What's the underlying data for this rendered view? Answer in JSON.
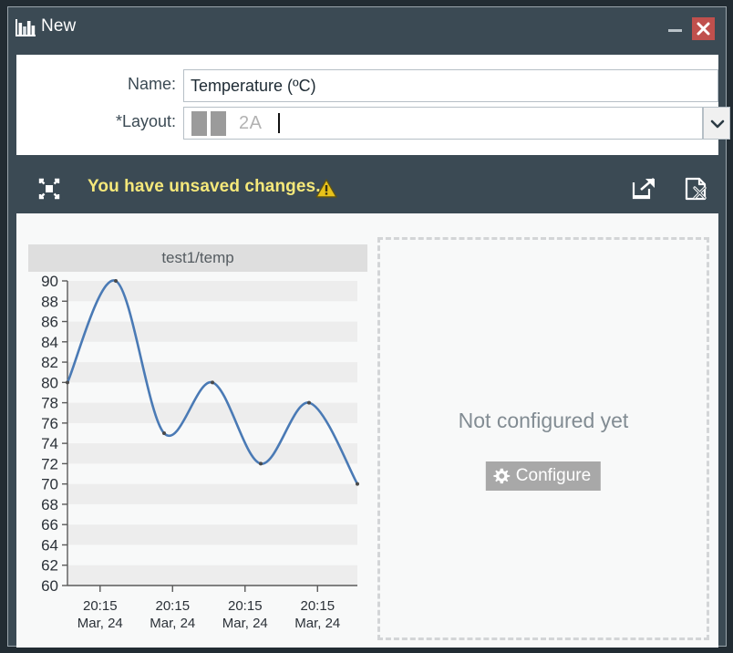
{
  "window": {
    "title": "New",
    "title_icon": "bar-chart-icon",
    "minimize_label": "–",
    "close_label": "✕",
    "close_color": "#c0504d"
  },
  "form": {
    "name": {
      "label": "Name:",
      "value": "Temperature (ºC)",
      "placeholder": ""
    },
    "layout": {
      "label": "*Layout:",
      "value": "2A",
      "swatch_count": 2,
      "dropdown_icon": "chevron-down-icon"
    }
  },
  "toolbar": {
    "expand_icon": "fullscreen-expand-icon",
    "status_message": "You have unsaved changes.",
    "status_color": "#f5e87a",
    "warning_icon": "warning-triangle-icon",
    "popout_icon": "open-in-new-window-icon",
    "discard_icon": "discard-document-icon"
  },
  "placeholder": {
    "message": "Not configured yet",
    "configure_label": "Configure",
    "configure_icon": "gear-icon"
  },
  "chart_data": {
    "type": "line",
    "title": "test1/temp",
    "xlabel": "",
    "ylabel": "",
    "ylim": [
      60,
      90
    ],
    "yticks": [
      90,
      88,
      86,
      84,
      82,
      80,
      78,
      76,
      74,
      72,
      70,
      68,
      66,
      64,
      62,
      60
    ],
    "xticks": [
      "20:15\nMar, 24",
      "20:15\nMar, 24",
      "20:15\nMar, 24",
      "20:15\nMar, 24"
    ],
    "xtick_time": "20:15",
    "xtick_date": "Mar, 24",
    "grid": "alternating-horizontal-bands",
    "band_color": "#ededed",
    "series": [
      {
        "name": "test1/temp",
        "color": "#4a7ab5",
        "values": [
          80,
          90,
          75,
          80,
          72,
          78,
          70
        ]
      }
    ]
  }
}
